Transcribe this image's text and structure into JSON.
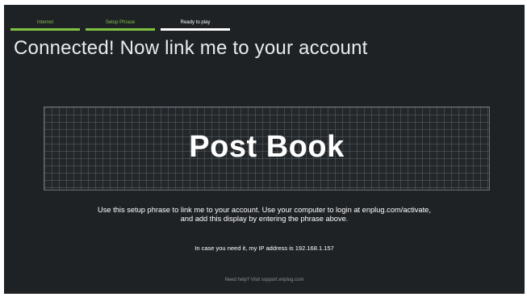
{
  "steps": [
    {
      "label": "Internet",
      "state": "done"
    },
    {
      "label": "Setup Phrase",
      "state": "done"
    },
    {
      "label": "Ready to play",
      "state": "current"
    }
  ],
  "headline": "Connected! Now link me to your account",
  "setup_phrase": "Post Book",
  "instructions": {
    "line1": "Use this setup phrase to link me to your account. Use your computer to login at enplug.com/activate,",
    "line2": "and add this display by entering the phrase above."
  },
  "ip_text": "In case you need it, my IP address is 192.168.1.157",
  "help_text": "Need help? Visit support.enplug.com",
  "colors": {
    "background": "#1f2225",
    "accent_done": "#7fc242",
    "accent_current": "#ffffff"
  }
}
